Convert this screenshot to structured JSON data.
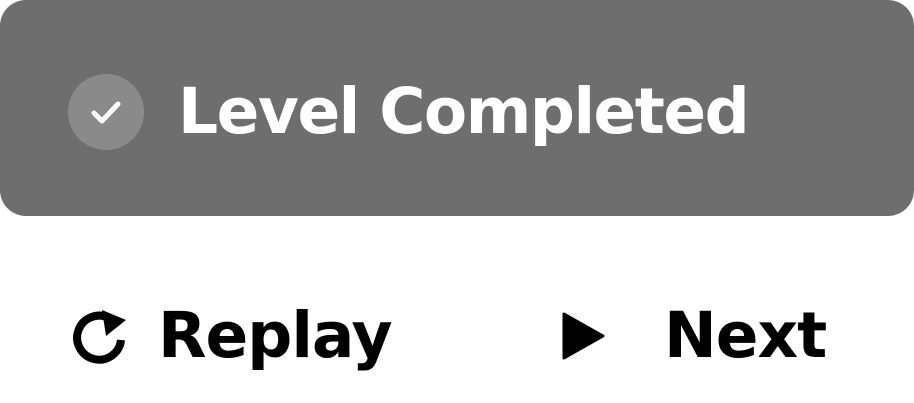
{
  "banner": {
    "title": "Level Completed",
    "icon": "check-icon",
    "background_color": "#6e6e6e",
    "icon_circle_color": "#8a8a8a",
    "text_color": "#ffffff"
  },
  "actions": {
    "replay": {
      "label": "Replay",
      "icon": "replay-icon"
    },
    "next": {
      "label": "Next",
      "icon": "play-icon"
    }
  }
}
